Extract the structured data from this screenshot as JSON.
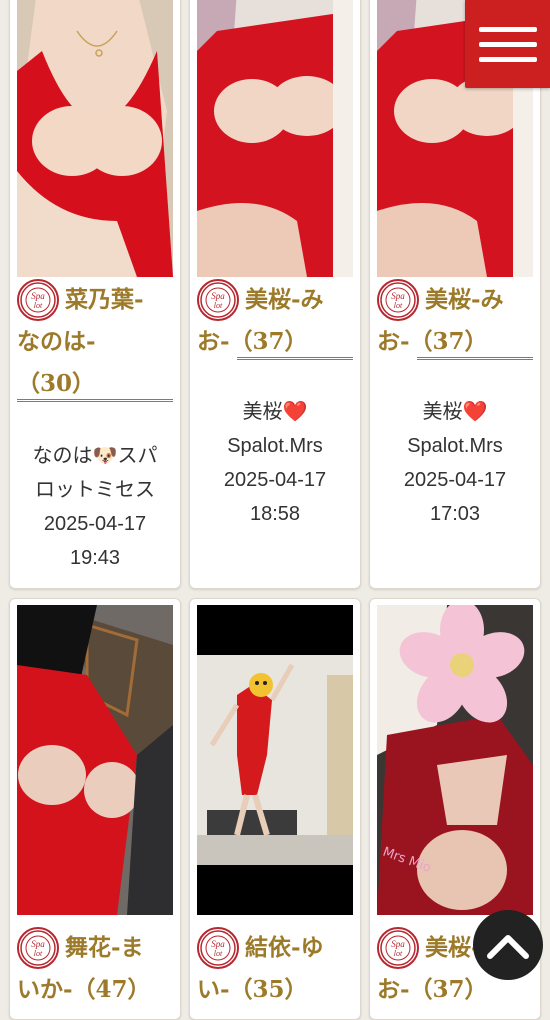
{
  "cards": [
    {
      "name_first": "菜乃葉-",
      "name_rest": "なのは-",
      "name_tail": "（30）",
      "info": [
        "なのは🐶スパ",
        "ロットミセス",
        "2025-04-17",
        "19:43"
      ]
    },
    {
      "name_first": "美桜-み",
      "name_rest": "お-（37）",
      "name_tail": "",
      "info": [
        "美桜❤️",
        "Spalot.Mrs",
        "2025-04-17",
        "18:58"
      ]
    },
    {
      "name_first": "美桜-み",
      "name_rest": "お-（37）",
      "name_tail": "",
      "info": [
        "美桜❤️",
        "Spalot.Mrs",
        "2025-04-17",
        "17:03"
      ]
    },
    {
      "name_first": "舞花-ま",
      "name_rest": "いか-（47）",
      "name_tail": "",
      "info": []
    },
    {
      "name_first": "結依-ゆ",
      "name_rest": "い-（35）",
      "name_tail": "",
      "info": []
    },
    {
      "name_first": "美桜-み",
      "name_rest": "お-（37）",
      "name_tail": "",
      "info": []
    }
  ],
  "logo_text": "Spa lot",
  "menu": {
    "icon": "hamburger-menu-icon"
  },
  "scroll_top": {
    "icon": "chevron-up-icon"
  },
  "colors": {
    "accent_red": "#cc1f1f",
    "gold": "#9c7a2a",
    "background": "#efece6"
  }
}
